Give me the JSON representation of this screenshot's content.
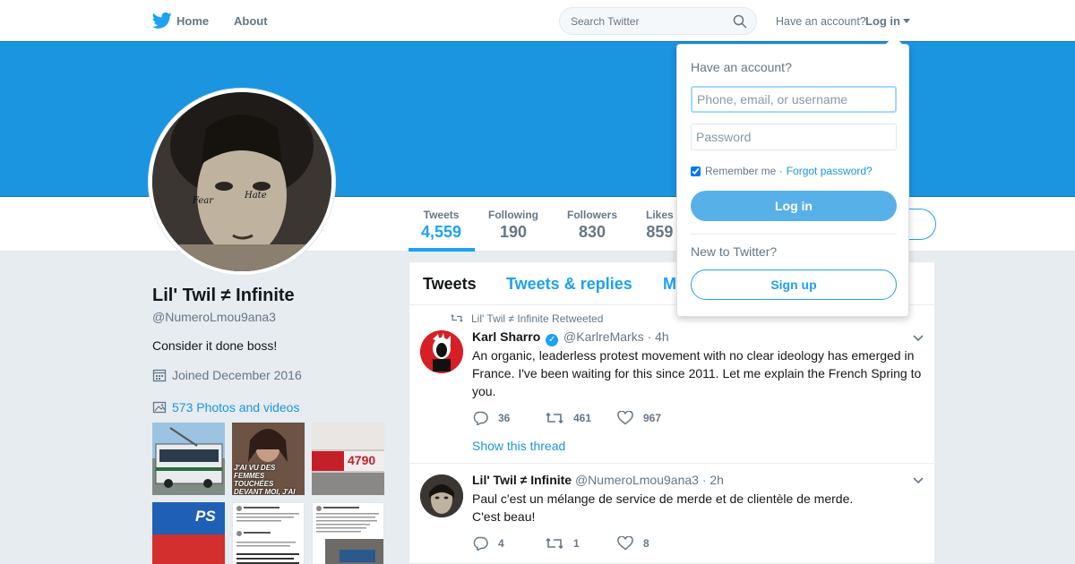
{
  "nav": {
    "home_label": "Home",
    "about_label": "About",
    "search_placeholder": "Search Twitter",
    "have_account": "Have an account?",
    "login_label": "Log in"
  },
  "profile": {
    "name": "Lil' Twil ≠ Infinite",
    "handle": "@NumeroLmou9ana3",
    "bio": "Consider it done boss!",
    "joined": "Joined December 2016",
    "photos_label": "573 Photos and videos",
    "avatar_tattoo_left": "Fear",
    "avatar_tattoo_right": "Hate"
  },
  "stats": [
    {
      "label": "Tweets",
      "value": "4,559"
    },
    {
      "label": "Following",
      "value": "190"
    },
    {
      "label": "Followers",
      "value": "830"
    },
    {
      "label": "Likes",
      "value": "859"
    }
  ],
  "thumbnails": [
    {
      "caption": ""
    },
    {
      "caption": "J'AI VU DES FEMMES TOUCHÉES DEVANT MOI, J'AI ÉTÉ AUSSI PLUSIEURS FOIS"
    },
    {
      "caption": "4790"
    },
    {
      "caption": "PS"
    },
    {
      "caption": ""
    },
    {
      "caption": ""
    }
  ],
  "timeline": {
    "tabs": [
      "Tweets",
      "Tweets & replies",
      "M"
    ]
  },
  "tweets": [
    {
      "retweet_by": "Lil' Twil ≠ Infinite Retweeted",
      "name": "Karl Sharro",
      "verified": true,
      "handle": "@KarlreMarks",
      "time": "· 4h",
      "text": "An organic, leaderless protest movement with no clear ideology has emerged in France. I've been waiting for this since 2011. Let me explain the French Spring to you.",
      "replies": "36",
      "retweets": "461",
      "likes": "967",
      "thread_link": "Show this thread"
    },
    {
      "name": "Lil' Twil ≠ Infinite",
      "handle": "@NumeroLmou9ana3",
      "time": "· 2h",
      "text_line1": "Paul c'est un mélange de service de merde et de clientèle de merde.",
      "text_line2": "C'est beau!",
      "replies": "4",
      "retweets": "1",
      "likes": "8"
    }
  ],
  "login_dropdown": {
    "title": "Have an account?",
    "username_placeholder": "Phone, email, or username",
    "password_placeholder": "Password",
    "remember_label": "Remember me ·",
    "remember_checked": true,
    "forgot_label": "Forgot password?",
    "login_button": "Log in",
    "new_label": "New to Twitter?",
    "signup_button": "Sign up"
  },
  "colors": {
    "brand_blue": "#1da1f2",
    "banner": "#1b95e0",
    "link": "#1b95e0",
    "muted": "#657786"
  }
}
